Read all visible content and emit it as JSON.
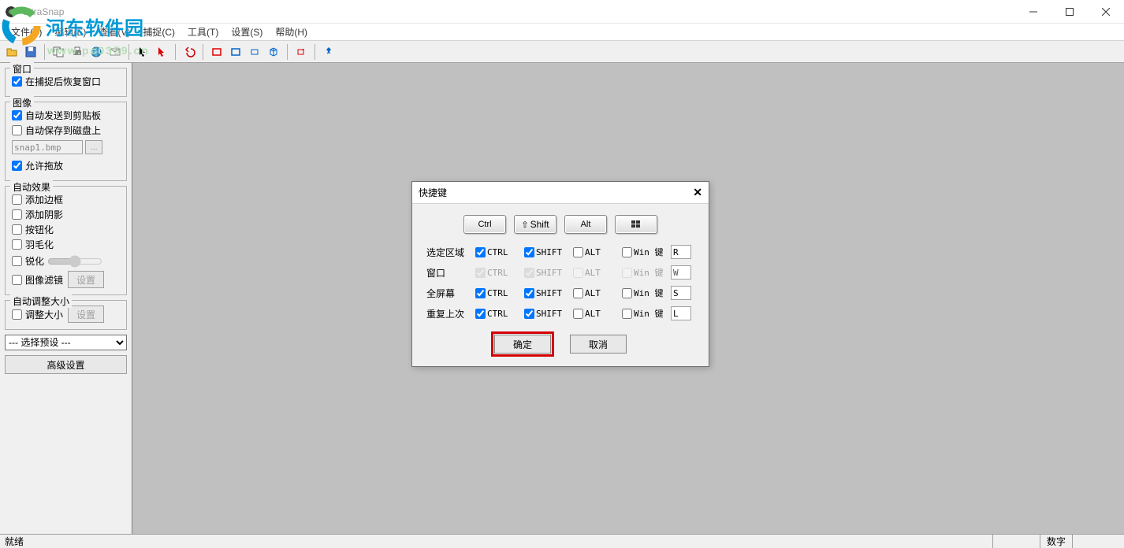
{
  "app": {
    "title": "UltraSnap"
  },
  "watermark": {
    "text": "河东软件园",
    "url": "www.pc0359.cn"
  },
  "menu": [
    "文件(F)",
    "编辑(E)",
    "查看(V)",
    "捕捉(C)",
    "工具(T)",
    "设置(S)",
    "帮助(H)"
  ],
  "sidebar": {
    "window_group": "窗口",
    "restore_after_capture": "在捕捉后恢复窗口",
    "image_group": "图像",
    "auto_clipboard": "自动发送到剪贴板",
    "auto_save_disk": "自动保存到磁盘上",
    "filename": "snap1.bmp",
    "allow_drag": "允许拖放",
    "auto_effect_group": "自动效果",
    "add_border": "添加边框",
    "add_shadow": "添加阴影",
    "buttonize": "按钮化",
    "feather": "羽毛化",
    "sharpen": "锐化",
    "image_filter": "图像滤镜",
    "settings_btn": "设置",
    "auto_resize_group": "自动调整大小",
    "resize": "调整大小",
    "select_preset": "--- 选择预设 ---",
    "advanced_btn": "高级设置"
  },
  "dialog": {
    "title": "快捷键",
    "mods": {
      "ctrl": "Ctrl",
      "shift": "Shift",
      "alt": "Alt",
      "win": ""
    },
    "cols": {
      "ctrl": "CTRL",
      "shift": "SHIFT",
      "alt": "ALT",
      "win": "Win 键"
    },
    "rows": [
      {
        "label": "选定区域",
        "ctrl": true,
        "shift": true,
        "alt": false,
        "win": false,
        "key": "R",
        "disabled": false
      },
      {
        "label": "窗口",
        "ctrl": true,
        "shift": true,
        "alt": false,
        "win": false,
        "key": "W",
        "disabled": true
      },
      {
        "label": "全屏幕",
        "ctrl": true,
        "shift": true,
        "alt": false,
        "win": false,
        "key": "S",
        "disabled": false
      },
      {
        "label": "重复上次",
        "ctrl": true,
        "shift": true,
        "alt": false,
        "win": false,
        "key": "L",
        "disabled": false
      }
    ],
    "ok": "确定",
    "cancel": "取消"
  },
  "status": {
    "ready": "就绪",
    "num": "数字"
  }
}
